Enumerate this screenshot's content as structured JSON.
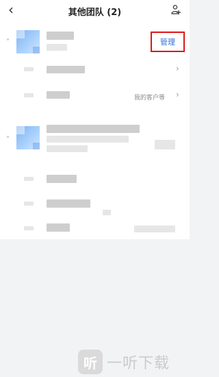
{
  "header": {
    "back_icon": "chevron-left-icon",
    "title": "其他团队 (2)",
    "add_user_icon": "person-add-icon"
  },
  "team1": {
    "manage_label": "管理",
    "row2_subtext": "我的客户等"
  },
  "chevron": "›",
  "watermark": {
    "icon_glyph": "听",
    "text": "一听下载"
  },
  "colors": {
    "manage_highlight": "#e01414",
    "manage_text": "#2f6fd6",
    "avatar_blue": "#7fb4f5"
  }
}
